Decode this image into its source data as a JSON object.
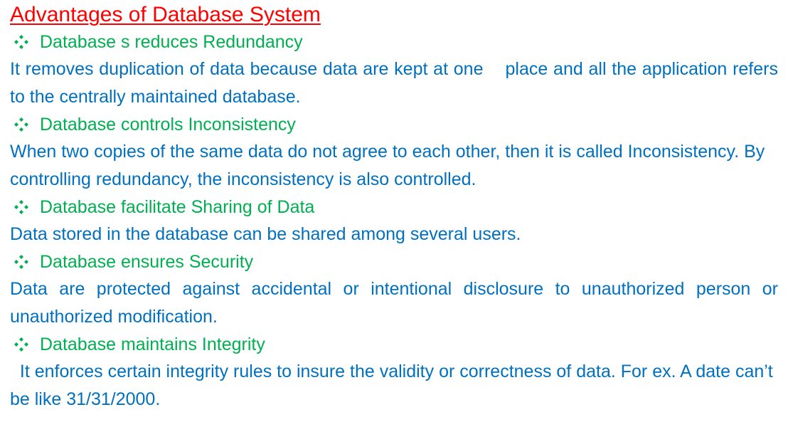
{
  "title": "Advantages of Database System",
  "accent_colors": {
    "title": "#ff0000",
    "heading": "#00b050",
    "body": "#0070c0"
  },
  "bullet_icon": "four-diamond-bullet-icon",
  "sections": [
    {
      "heading": "Database s reduces Redundancy",
      "body": "It removes duplication of data because data are kept at one    place and all the application refers to the centrally maintained database."
    },
    {
      "heading": "Database controls Inconsistency",
      "body": "When two copies of the same data do not agree to each other, then it is called Inconsistency. By controlling redundancy, the inconsistency is also controlled."
    },
    {
      "heading": "Database facilitate Sharing of Data",
      "body": "Data stored in the database can be shared among several users."
    },
    {
      "heading": "Database ensures Security",
      "body": "Data are protected against accidental or intentional disclosure to unauthorized person or unauthorized modification."
    },
    {
      "heading": "Database maintains Integrity",
      "body": "  It enforces certain integrity rules to insure the validity or correctness of data. For ex. A date can’t be like 31/31/2000."
    }
  ]
}
